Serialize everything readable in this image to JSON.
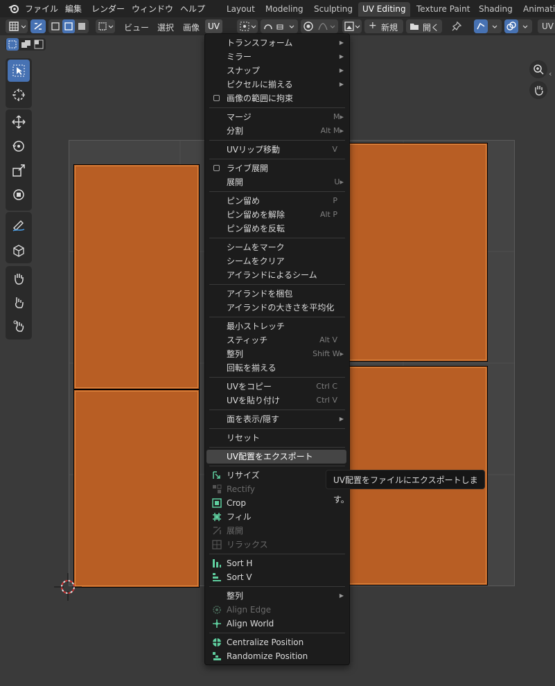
{
  "topbar": {
    "menus": [
      "ファイル",
      "編集",
      "レンダー",
      "ウィンドウ",
      "ヘルプ"
    ],
    "workspaces": [
      "Layout",
      "Modeling",
      "Sculpting",
      "UV Editing",
      "Texture Paint",
      "Shading",
      "Animatio"
    ]
  },
  "header": {
    "menus": [
      "ビュー",
      "選択",
      "画像",
      "UV"
    ],
    "new_label": "新規",
    "open_label": "開く",
    "right_label": "UV"
  },
  "menu": {
    "items": [
      {
        "label": "トランスフォーム",
        "arrow": true
      },
      {
        "label": "ミラー",
        "arrow": true
      },
      {
        "label": "スナップ",
        "arrow": true
      },
      {
        "label": "ピクセルに揃える",
        "arrow": true
      },
      {
        "label": "画像の範囲に拘束",
        "check": true
      },
      {
        "label": "マージ",
        "shortcut": "M▸"
      },
      {
        "label": "分割",
        "shortcut": "Alt M▸"
      },
      {
        "label": "UVリップ移動",
        "shortcut": "V"
      },
      {
        "label": "ライブ展開",
        "check": true
      },
      {
        "label": "展開",
        "shortcut": "U▸"
      },
      {
        "label": "ピン留め",
        "shortcut": "P"
      },
      {
        "label": "ピン留めを解除",
        "shortcut": "Alt P"
      },
      {
        "label": "ピン留めを反転"
      },
      {
        "label": "シームをマーク"
      },
      {
        "label": "シームをクリア"
      },
      {
        "label": "アイランドによるシーム"
      },
      {
        "label": "アイランドを梱包"
      },
      {
        "label": "アイランドの大きさを平均化"
      },
      {
        "label": "最小ストレッチ"
      },
      {
        "label": "スティッチ",
        "shortcut": "Alt V"
      },
      {
        "label": "整列",
        "shortcut": "Shift W▸"
      },
      {
        "label": "回転を揃える"
      },
      {
        "label": "UVをコピー",
        "shortcut": "Ctrl C"
      },
      {
        "label": "UVを貼り付け",
        "shortcut": "Ctrl V"
      },
      {
        "label": "面を表示/隠す",
        "arrow": true
      },
      {
        "label": "リセット"
      },
      {
        "label": "UV配置をエクスポート",
        "highlight": true
      },
      {
        "label": "リサイズ",
        "icon": "resize-icon"
      },
      {
        "label": "Rectify",
        "icon": "rectify-icon",
        "disabled": true
      },
      {
        "label": "Crop",
        "icon": "crop-icon"
      },
      {
        "label": "フィル",
        "icon": "fill-icon"
      },
      {
        "label": "展開",
        "icon": "unwrap-icon",
        "disabled": true
      },
      {
        "label": "リラックス",
        "icon": "relax-icon",
        "disabled": true
      },
      {
        "label": "Sort H",
        "icon": "sort-h-icon"
      },
      {
        "label": "Sort V",
        "icon": "sort-v-icon"
      },
      {
        "label": "整列",
        "arrow": true
      },
      {
        "label": "Align Edge",
        "icon": "align-edge-icon",
        "disabled": true
      },
      {
        "label": "Align World",
        "icon": "align-world-icon"
      },
      {
        "label": "Centralize Position",
        "icon": "centralize-icon"
      },
      {
        "label": "Randomize Position",
        "icon": "randomize-icon"
      }
    ]
  },
  "tooltip": "UV配置をファイルにエクスポートします。",
  "colors": {
    "accent": "#4772b3",
    "island": "#b85e24",
    "island_edge": "#e38a40",
    "menu_bg": "#1c1c1c",
    "icon_green": "#5fcf9f"
  }
}
